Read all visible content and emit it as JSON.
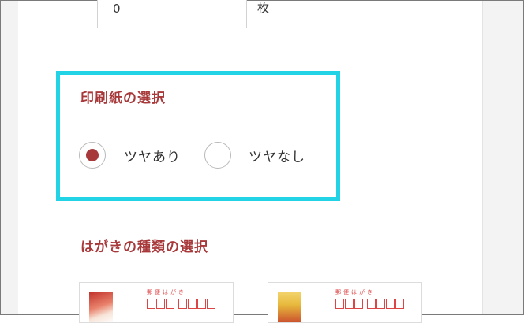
{
  "quantity": {
    "value": "0",
    "unit": "枚"
  },
  "paper_selection": {
    "title": "印刷紙の選択",
    "options": [
      {
        "label": "ツヤあり",
        "selected": true
      },
      {
        "label": "ツヤなし",
        "selected": false
      }
    ]
  },
  "card_type_selection": {
    "title": "はがきの種類の選択",
    "cards": [
      {
        "postal_label": "郵便はがき"
      },
      {
        "postal_label": "郵便はがき"
      }
    ]
  },
  "colors": {
    "accent": "#a8393b",
    "highlight": "#22d3e6"
  }
}
